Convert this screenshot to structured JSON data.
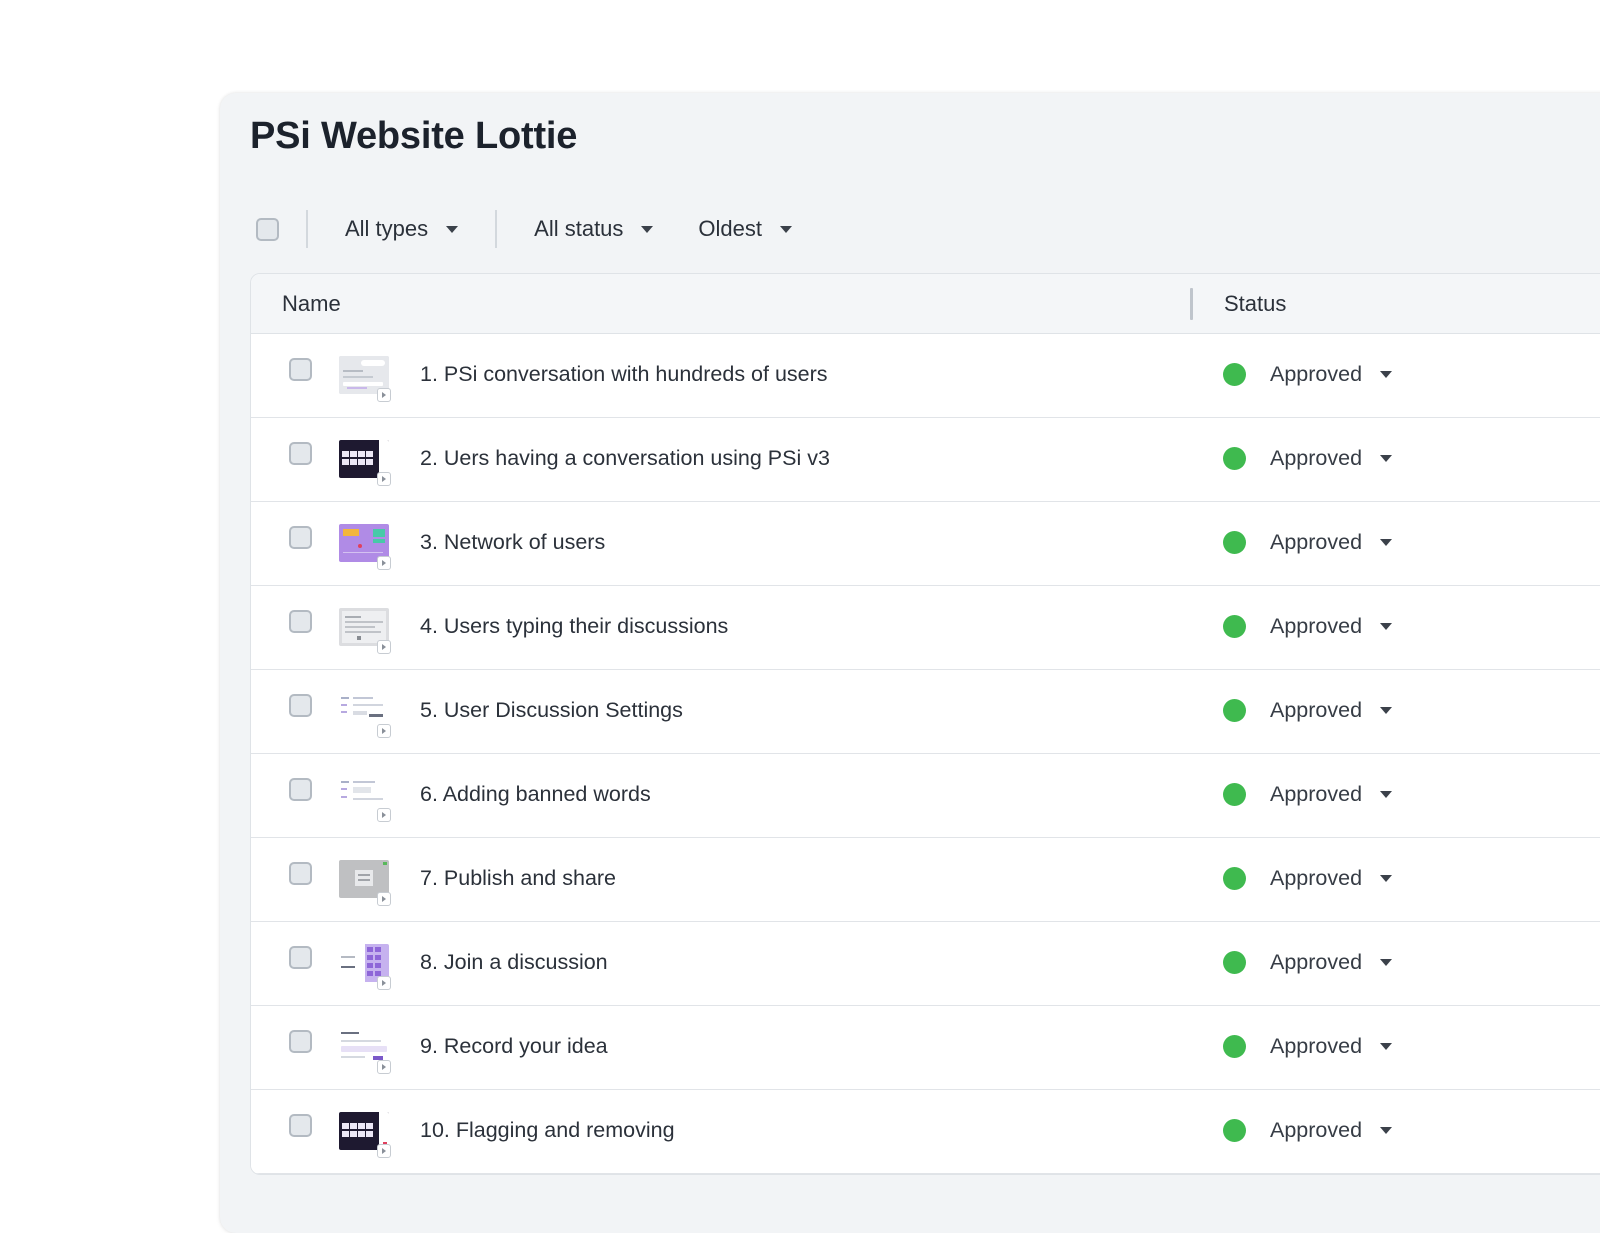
{
  "page": {
    "title": "PSi Website Lottie"
  },
  "toolbar": {
    "types_label": "All types",
    "status_label": "All status",
    "sort_label": "Oldest"
  },
  "table": {
    "columns": {
      "name": "Name",
      "status": "Status"
    },
    "rows": [
      {
        "name": "1. PSi conversation with hundreds of users",
        "status": "Approved"
      },
      {
        "name": "2. Uers having a conversation using PSi v3",
        "status": "Approved"
      },
      {
        "name": "3. Network of users",
        "status": "Approved"
      },
      {
        "name": "4. Users typing their discussions",
        "status": "Approved"
      },
      {
        "name": "5. User Discussion Settings",
        "status": "Approved"
      },
      {
        "name": "6. Adding banned words",
        "status": "Approved"
      },
      {
        "name": "7. Publish and share",
        "status": "Approved"
      },
      {
        "name": "8. Join a discussion",
        "status": "Approved"
      },
      {
        "name": "9. Record your idea",
        "status": "Approved"
      },
      {
        "name": "10. Flagging and removing",
        "status": "Approved"
      }
    ]
  },
  "colors": {
    "approved": "#3fba4f",
    "panel_bg": "#f2f4f6"
  },
  "icons": {
    "dropdown": "caret-down-icon",
    "status": "status-dot-icon",
    "video": "play-icon"
  }
}
